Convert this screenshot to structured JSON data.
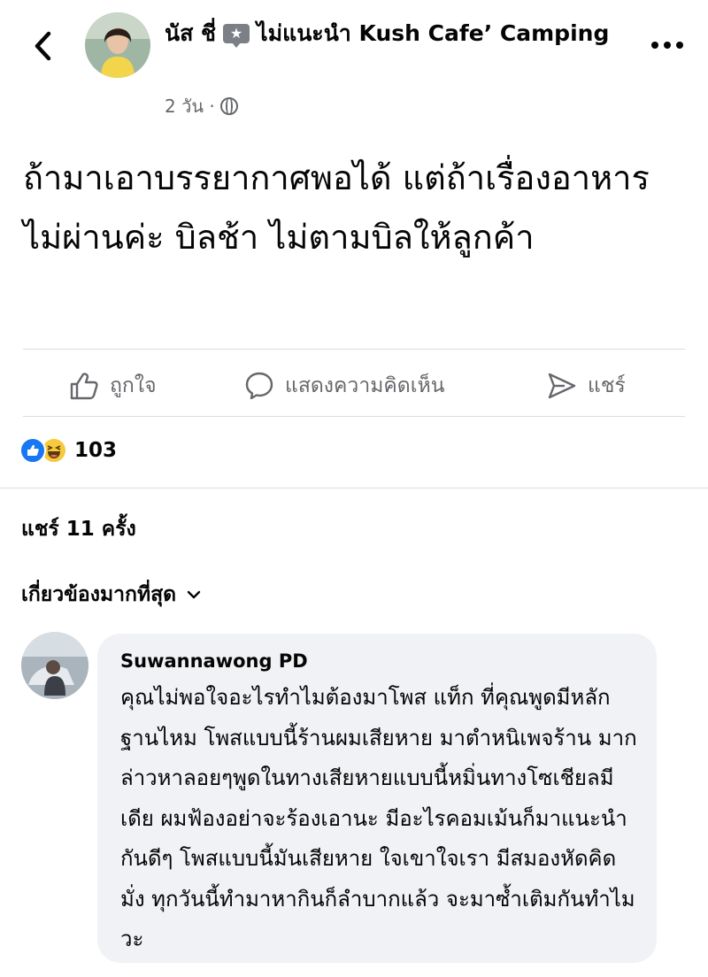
{
  "header": {
    "poster_name": "นัส ชี่",
    "recommend_icon": "star-badge-icon",
    "recommend_text": "ไม่แนะนำ Kush Cafe’ Camping",
    "time": "2 วัน ·",
    "privacy_icon": "globe-icon"
  },
  "post": {
    "text": "ถ้ามาเอาบรรยากาศพอได้ แต่ถ้าเรื่องอาหารไม่ผ่านค่ะ บิลช้า ไม่ตามบิลให้ลูกค้า"
  },
  "actions": {
    "like_label": "ถูกใจ",
    "comment_label": "แสดงความคิดเห็น",
    "share_label": "แชร์"
  },
  "reactions": {
    "count": "103",
    "types": [
      "like",
      "haha"
    ]
  },
  "share_count_label": "แชร์ 11 ครั้ง",
  "sort_label": "เกี่ยวข้องมากที่สุด",
  "comment": {
    "author": "Suwannawong PD",
    "text": "คุณไม่พอใจอะไรทำไมต้องมาโพส แท็ก ที่คุณพูดมีหลักฐานไหม โพสแบบนี้ร้านผมเสียหาย มาตำหนิเพจร้าน มากล่าวหาลอยๆพูดในทางเสียหายแบบนี้หมิ่นทางโซเชียลมีเดีย ผมฟ้องอย่าจะร้องเอานะ มีอะไรคอมเม้นก็มาแนะนำกันดีๆ โพสแบบนี้มันเสียหาย ใจเขาใจเรา มีสมองหัดคิดมั่ง ทุกวันนี้ทำมาหากินก็ลำบากแล้ว จะมาซ้ำเติมกันทำไมวะ"
  }
}
